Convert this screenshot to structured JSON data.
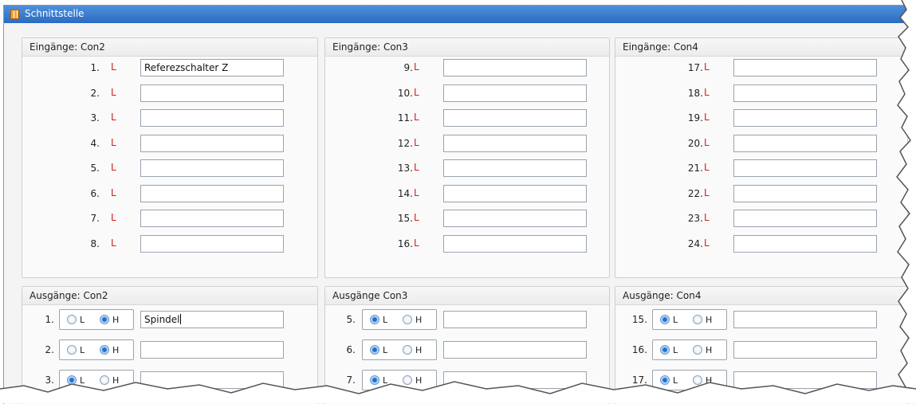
{
  "window": {
    "title": "Schnittstelle"
  },
  "inputs": [
    {
      "title": "Eingänge: Con2",
      "rows": [
        {
          "num": "1.",
          "level": "L",
          "value": "Referezschalter Z"
        },
        {
          "num": "2.",
          "level": "L",
          "value": ""
        },
        {
          "num": "3.",
          "level": "L",
          "value": ""
        },
        {
          "num": "4.",
          "level": "L",
          "value": ""
        },
        {
          "num": "5.",
          "level": "L",
          "value": ""
        },
        {
          "num": "6.",
          "level": "L",
          "value": ""
        },
        {
          "num": "7.",
          "level": "L",
          "value": ""
        },
        {
          "num": "8.",
          "level": "L",
          "value": ""
        }
      ]
    },
    {
      "title": "Eingänge: Con3",
      "rows": [
        {
          "num": "9.",
          "level": "L",
          "value": ""
        },
        {
          "num": "10.",
          "level": "L",
          "value": ""
        },
        {
          "num": "11.",
          "level": "L",
          "value": ""
        },
        {
          "num": "12.",
          "level": "L",
          "value": ""
        },
        {
          "num": "13.",
          "level": "L",
          "value": ""
        },
        {
          "num": "14.",
          "level": "L",
          "value": ""
        },
        {
          "num": "15.",
          "level": "L",
          "value": ""
        },
        {
          "num": "16.",
          "level": "L",
          "value": ""
        }
      ]
    },
    {
      "title": "Eingänge: Con4",
      "rows": [
        {
          "num": "17.",
          "level": "L",
          "value": ""
        },
        {
          "num": "18.",
          "level": "L",
          "value": ""
        },
        {
          "num": "19.",
          "level": "L",
          "value": ""
        },
        {
          "num": "20.",
          "level": "L",
          "value": ""
        },
        {
          "num": "21.",
          "level": "L",
          "value": ""
        },
        {
          "num": "22.",
          "level": "L",
          "value": ""
        },
        {
          "num": "23.",
          "level": "L",
          "value": ""
        },
        {
          "num": "24.",
          "level": "L",
          "value": ""
        }
      ]
    }
  ],
  "outputs": [
    {
      "title": "Ausgänge: Con2",
      "rows": [
        {
          "num": "1.",
          "selected": "H",
          "value": "Spindel"
        },
        {
          "num": "2.",
          "selected": "H",
          "value": ""
        },
        {
          "num": "3.",
          "selected": "L",
          "value": ""
        }
      ]
    },
    {
      "title": "Ausgänge Con3",
      "rows": [
        {
          "num": "5.",
          "selected": "L",
          "value": ""
        },
        {
          "num": "6.",
          "selected": "L",
          "value": ""
        },
        {
          "num": "7.",
          "selected": "L",
          "value": ""
        }
      ]
    },
    {
      "title": "Ausgänge: Con4",
      "rows": [
        {
          "num": "15.",
          "selected": "L",
          "value": ""
        },
        {
          "num": "16.",
          "selected": "L",
          "value": ""
        },
        {
          "num": "17.",
          "selected": "L",
          "value": ""
        }
      ]
    }
  ],
  "radio_labels": {
    "low": "L",
    "high": "H"
  },
  "colors": {
    "titlebar": "#2a6cc4",
    "level_marker": "#d32020",
    "radio_selected": "#1f6fd0"
  }
}
